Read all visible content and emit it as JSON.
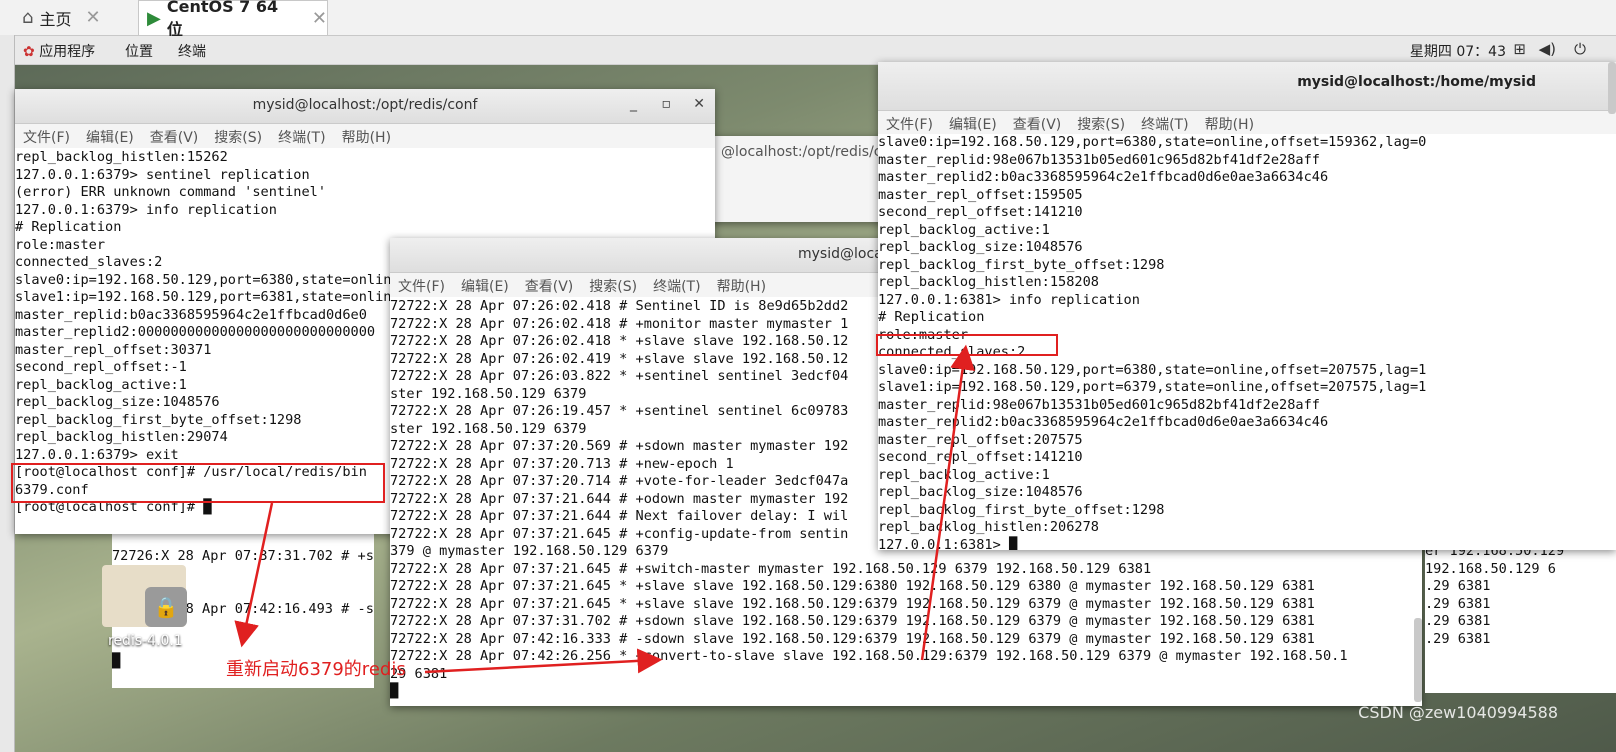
{
  "vm_tabs": [
    {
      "label": "主页",
      "icon": "home-icon",
      "close": "✕"
    },
    {
      "label": "CentOS 7 64 位",
      "icon": "vm-icon",
      "close": "✕"
    }
  ],
  "gnome_bar": {
    "menus": [
      "应用程序",
      "位置",
      "终端"
    ],
    "clock": "星期四 07：43"
  },
  "terminal_menu": [
    "文件(F)",
    "编辑(E)",
    "查看(V)",
    "搜索(S)",
    "终端(T)",
    "帮助(H)"
  ],
  "back_window": {
    "title_fragment": "@localhost:/opt/redis/co"
  },
  "win1": {
    "title": "mysid@localhost:/opt/redis/conf",
    "lines": [
      "repl_backlog_histlen:15262",
      "127.0.0.1:6379> sentinel replication",
      "(error) ERR unknown command 'sentinel'",
      "127.0.0.1:6379> info replication",
      "# Replication",
      "role:master",
      "connected_slaves:2",
      "slave0:ip=192.168.50.129,port=6380,state=online",
      "slave1:ip=192.168.50.129,port=6381,state=online",
      "master_replid:b0ac3368595964c2e1ffbcad0d6e0",
      "master_replid2:00000000000000000000000000000",
      "master_repl_offset:30371",
      "second_repl_offset:-1",
      "repl_backlog_active:1",
      "repl_backlog_size:1048576",
      "repl_backlog_first_byte_offset:1298",
      "repl_backlog_histlen:29074",
      "127.0.0.1:6379> exit",
      "[root@localhost conf]# /usr/local/redis/bin",
      "6379.conf",
      "[root@localhost conf]# █"
    ]
  },
  "behind_lines": [
    "72726:X 28 Apr 07:37:31.702 # +s",
    "72726:X 28 Apr 07:42:16.493 # -s",
    "█"
  ],
  "win2": {
    "title": "mysid@loca",
    "lines": [
      "72722:X 28 Apr 07:26:02.418 # Sentinel ID is 8e9d65b2dd2",
      "72722:X 28 Apr 07:26:02.418 # +monitor master mymaster 1",
      "72722:X 28 Apr 07:26:02.418 * +slave slave 192.168.50.12",
      "72722:X 28 Apr 07:26:02.419 * +slave slave 192.168.50.12",
      "72722:X 28 Apr 07:26:03.822 * +sentinel sentinel 3edcf04",
      "ster 192.168.50.129 6379",
      "72722:X 28 Apr 07:26:19.457 * +sentinel sentinel 6c09783",
      "ster 192.168.50.129 6379",
      "72722:X 28 Apr 07:37:20.569 # +sdown master mymaster 192",
      "72722:X 28 Apr 07:37:20.713 # +new-epoch 1",
      "72722:X 28 Apr 07:37:20.714 # +vote-for-leader 3edcf047a",
      "72722:X 28 Apr 07:37:21.644 # +odown master mymaster 192",
      "72722:X 28 Apr 07:37:21.644 # Next failover delay: I wil",
      "72722:X 28 Apr 07:37:21.645 # +config-update-from sentin",
      "379 @ mymaster 192.168.50.129 6379",
      "72722:X 28 Apr 07:37:21.645 # +switch-master mymaster 192.168.50.129 6379 192.168.50.129 6381",
      "72722:X 28 Apr 07:37:21.645 * +slave slave 192.168.50.129:6380 192.168.50.129 6380 @ mymaster 192.168.50.129 6381",
      "72722:X 28 Apr 07:37:21.645 * +slave slave 192.168.50.129:6379 192.168.50.129 6379 @ mymaster 192.168.50.129 6381",
      "72722:X 28 Apr 07:37:31.702 # +sdown slave 192.168.50.129:6379 192.168.50.129 6379 @ mymaster 192.168.50.129 6381",
      "72722:X 28 Apr 07:42:16.333 # -sdown slave 192.168.50.129:6379 192.168.50.129 6379 @ mymaster 192.168.50.129 6381",
      "72722:X 28 Apr 07:42:26.256 * +convert-to-slave slave 192.168.50.129:6379 192.168.50.129 6379 @ mymaster 192.168.50.1",
      "29 6381",
      "█"
    ]
  },
  "win3": {
    "title": "mysid@localhost:/home/mysid",
    "lines": [
      "slave0:ip=192.168.50.129,port=6380,state=online,offset=159362,lag=0",
      "master_replid:98e067b13531b05ed601c965d82bf41df2e28aff",
      "master_replid2:b0ac3368595964c2e1ffbcad0d6e0ae3a6634c46",
      "master_repl_offset:159505",
      "second_repl_offset:141210",
      "repl_backlog_active:1",
      "repl_backlog_size:1048576",
      "repl_backlog_first_byte_offset:1298",
      "repl_backlog_histlen:158208",
      "127.0.0.1:6381> info replication",
      "# Replication",
      "role:master",
      "connected_slaves:2",
      "slave0:ip=192.168.50.129,port=6380,state=online,offset=207575,lag=1",
      "slave1:ip=192.168.50.129,port=6379,state=online,offset=207575,lag=1",
      "master_replid:98e067b13531b05ed601c965d82bf41df2e28aff",
      "master_replid2:b0ac3368595964c2e1ffbcad0d6e0ae3a6634c46",
      "master_repl_offset:207575",
      "second_repl_offset:141210",
      "repl_backlog_active:1",
      "repl_backlog_size:1048576",
      "repl_backlog_first_byte_offset:1298",
      "repl_backlog_histlen:206278",
      "127.0.0.1:6381> █"
    ]
  },
  "right_fragments": [
    "er 192.168.50.129",
    "192.168.50.129 6",
    "",
    "",
    ".29 6381",
    ".29 6381",
    ".29 6381",
    ".29 6381"
  ],
  "desktop_icon": {
    "label": "redis-4.0.1"
  },
  "annotation": "重新启动6379的redis",
  "watermark": "CSDN @zew1040994588",
  "colors": {
    "annotation_red": "#e02020"
  }
}
